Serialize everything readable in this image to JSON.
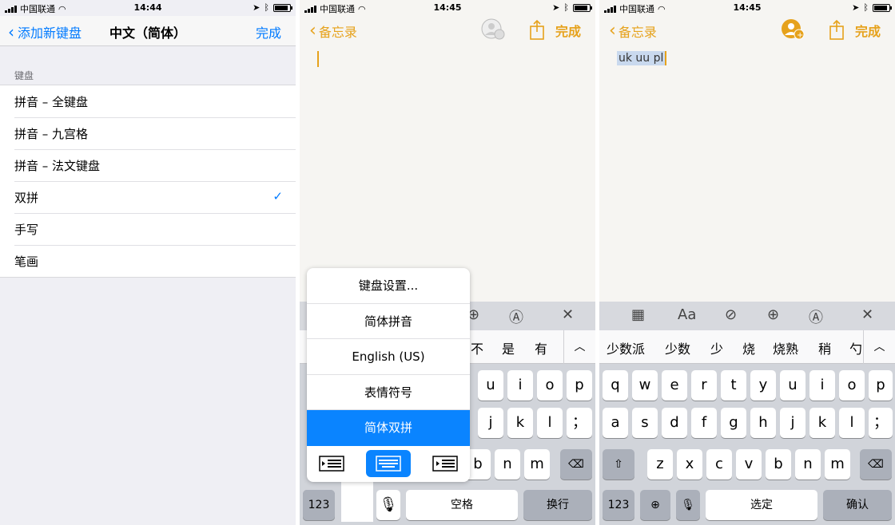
{
  "status": {
    "carrier": "中国联通",
    "times": [
      "14:44",
      "14:45",
      "14:45"
    ]
  },
  "settings": {
    "back_label": "添加新键盘",
    "title": "中文（简体）",
    "done_label": "完成",
    "section_label": "键盘",
    "rows": [
      "拼音 – 全键盘",
      "拼音 – 九宫格",
      "拼音 – 法文键盘",
      "双拼",
      "手写",
      "笔画"
    ],
    "checked_index": 3,
    "check_glyph": "✓"
  },
  "notes": {
    "back_label": "备忘录",
    "done_label": "完成",
    "typed_text": "uk uu pl",
    "accent": "#e6a21c"
  },
  "popup": {
    "items": [
      "键盘设置...",
      "简体拼音",
      "English (US)",
      "表情符号",
      "简体双拼"
    ],
    "selected_index": 4,
    "selected_color": "#0a84ff"
  },
  "kb2": {
    "candidates": [
      "不",
      "是",
      "有"
    ],
    "expand": "︿",
    "row1": [
      "u",
      "i",
      "o",
      "p"
    ],
    "row2": [
      "j",
      "k",
      "l",
      "；"
    ],
    "row3": [
      "b",
      "n",
      "m"
    ],
    "num_label": "123",
    "space_label": "空格",
    "return_label": "换行"
  },
  "kb3": {
    "toolbar": [
      "▦",
      "Aa",
      "⊘",
      "⊕",
      "Ⓐ",
      "✕"
    ],
    "candidates": [
      "少数派",
      "少数",
      "少",
      "烧",
      "烧熟",
      "稍",
      "勺"
    ],
    "expand": "︿",
    "row1": [
      "q",
      "w",
      "e",
      "r",
      "t",
      "y",
      "u",
      "i",
      "o",
      "p"
    ],
    "row2": [
      "a",
      "s",
      "d",
      "f",
      "g",
      "h",
      "j",
      "k",
      "l",
      "；"
    ],
    "row3": [
      "z",
      "x",
      "c",
      "v",
      "b",
      "n",
      "m"
    ],
    "num_label": "123",
    "select_label": "选定",
    "confirm_label": "确认"
  }
}
